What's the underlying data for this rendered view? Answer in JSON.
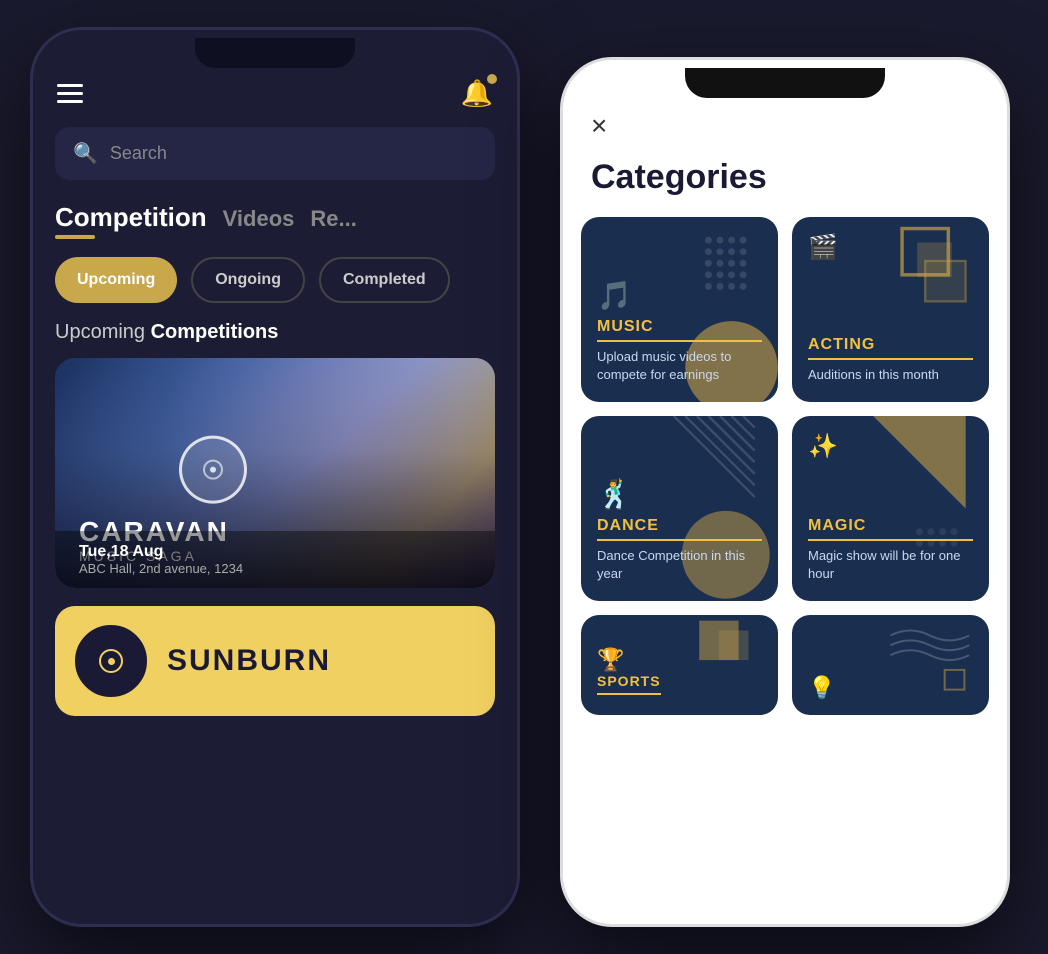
{
  "phone_left": {
    "search_placeholder": "Search",
    "tabs": [
      {
        "label": "Competition",
        "active": true
      },
      {
        "label": "Videos",
        "active": false
      },
      {
        "label": "Re...",
        "active": false
      }
    ],
    "filters": [
      {
        "label": "Upcoming",
        "active": true
      },
      {
        "label": "Ongoing",
        "active": false
      },
      {
        "label": "Completed",
        "active": false
      }
    ],
    "section_title_plain": "Upcoming",
    "section_title_bold": "Competitions",
    "card1": {
      "date": "Tue,18 Aug",
      "venue": "ABC Hall, 2nd avenue, 1234",
      "event_name": "CARAVAN",
      "event_sub": "MUSIC SAGA"
    },
    "card2": {
      "event_name": "SUNBURN"
    }
  },
  "phone_right": {
    "close_icon": "×",
    "title": "Categories",
    "categories": [
      {
        "id": "music",
        "icon": "🎵",
        "title": "MUSIC",
        "desc": "Upload music videos to compete for earnings",
        "deco": "dots"
      },
      {
        "id": "acting",
        "icon": "🎬",
        "title": "ACTING",
        "desc": "Auditions in this month",
        "deco": "squares"
      },
      {
        "id": "dance",
        "icon": "🕺",
        "title": "DANCE",
        "desc": "Dance Competition in this year",
        "deco": "lines"
      },
      {
        "id": "magic",
        "icon": "✨",
        "title": "MAGIC",
        "desc": "Magic show will be for one hour",
        "deco": "triangle"
      }
    ],
    "bottom_categories": [
      {
        "id": "sports",
        "icon": "🏆",
        "title": "SPORTS",
        "deco": "square-shape"
      },
      {
        "id": "unknown",
        "icon": "💡",
        "title": "",
        "deco": "wave"
      }
    ]
  }
}
